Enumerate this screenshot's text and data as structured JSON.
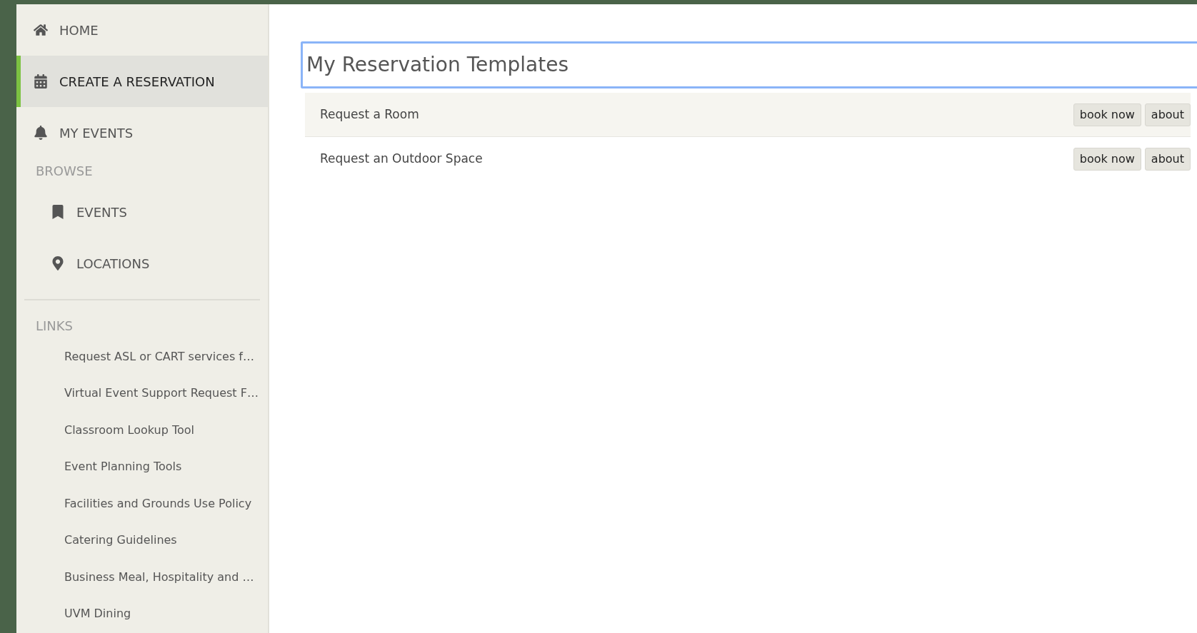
{
  "sidebar": {
    "nav": [
      {
        "label": "HOME",
        "selected": false
      },
      {
        "label": "CREATE A RESERVATION",
        "selected": true
      },
      {
        "label": "MY EVENTS",
        "selected": false
      }
    ],
    "browse": {
      "heading": "BROWSE",
      "items": [
        {
          "label": "EVENTS",
          "selected": false
        },
        {
          "label": "LOCATIONS",
          "selected": false
        }
      ]
    },
    "links": {
      "heading": "LINKS",
      "items": [
        "Request ASL or CART services f…",
        "Virtual Event Support Request F…",
        "Classroom Lookup Tool",
        "Event Planning Tools",
        "Facilities and Grounds Use Policy",
        "Catering Guidelines",
        "Business Meal, Hospitality and …",
        "UVM Dining"
      ]
    }
  },
  "main": {
    "title": "My Reservation Templates",
    "templates": [
      {
        "name": "Request a Room",
        "highlighted": true,
        "buttons": [
          "book now",
          "about"
        ]
      },
      {
        "name": "Request an Outdoor Space",
        "highlighted": false,
        "buttons": [
          "book now",
          "about"
        ]
      }
    ]
  }
}
